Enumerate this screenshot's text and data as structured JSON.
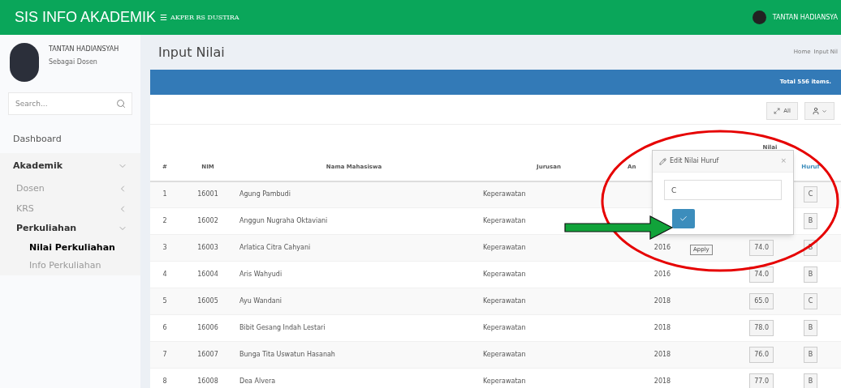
{
  "topbar": {
    "brand": "SIS INFO AKADEMIK",
    "menu_icon": "☰",
    "institution": "AKPER RS DUSTIRA",
    "user": "TANTAN HADIANSYA"
  },
  "sidebar": {
    "user_name": "TANTAN HADIANSYAH",
    "user_role": "Sebagai Dosen",
    "search": {
      "placeholder": "Search..."
    },
    "items": [
      {
        "label": "Dashboard",
        "expanded": false,
        "selected": false
      },
      {
        "label": "Akademik",
        "expanded": true,
        "selected": false,
        "children": [
          {
            "label": "Dosen",
            "expanded": false,
            "selected": false
          },
          {
            "label": "KRS",
            "expanded": false,
            "selected": false
          },
          {
            "label": "Perkuliahan",
            "expanded": true,
            "selected": false,
            "children": [
              {
                "label": "Nilai Perkuliahan",
                "selected": true
              },
              {
                "label": "Info Perkuliahan",
                "selected": false
              }
            ]
          }
        ]
      }
    ]
  },
  "page": {
    "title": "Input Nilai",
    "breadcrumb": [
      "Home",
      "Input Nil"
    ]
  },
  "panel": {
    "total": "Total 556 items.",
    "toolbar": {
      "expand_label": "All"
    }
  },
  "table": {
    "group_header": "Nilai",
    "columns": [
      "#",
      "NIM",
      "Nama Mahasiswa",
      "Jurusan",
      "An",
      "",
      "Huruf"
    ],
    "rows": [
      {
        "no": "1",
        "nim": "16001",
        "name": "Agung Pambudi",
        "jurusan": "Keperawatan",
        "huruf": "C"
      },
      {
        "no": "2",
        "nim": "16002",
        "name": "Anggun Nugraha Oktaviani",
        "jurusan": "Keperawatan",
        "huruf": "B"
      },
      {
        "no": "3",
        "nim": "16003",
        "name": "Arlatica Citra Cahyani",
        "jurusan": "Keperawatan",
        "angkatan": "2016",
        "nilai": "74.0",
        "huruf": "B"
      },
      {
        "no": "4",
        "nim": "16004",
        "name": "Aris Wahyudi",
        "jurusan": "Keperawatan",
        "angkatan": "2016",
        "nilai": "74.0",
        "huruf": "B"
      },
      {
        "no": "5",
        "nim": "16005",
        "name": "Ayu Wandani",
        "jurusan": "Keperawatan",
        "angkatan": "2018",
        "nilai": "65.0",
        "huruf": "C"
      },
      {
        "no": "6",
        "nim": "16006",
        "name": "Bibit Gesang Indah Lestari",
        "jurusan": "Keperawatan",
        "angkatan": "2018",
        "nilai": "78.0",
        "huruf": "B"
      },
      {
        "no": "7",
        "nim": "16007",
        "name": "Bunga Tita Uswatun Hasanah",
        "jurusan": "Keperawatan",
        "angkatan": "2018",
        "nilai": "76.0",
        "huruf": "B"
      },
      {
        "no": "8",
        "nim": "16008",
        "name": "Dea Alvera",
        "jurusan": "Keperawatan",
        "angkatan": "2018",
        "nilai": "77.0",
        "huruf": "B"
      }
    ]
  },
  "popover": {
    "title": "Edit Nilai Huruf",
    "close": "×",
    "value": "C",
    "tooltip": "Apply"
  }
}
